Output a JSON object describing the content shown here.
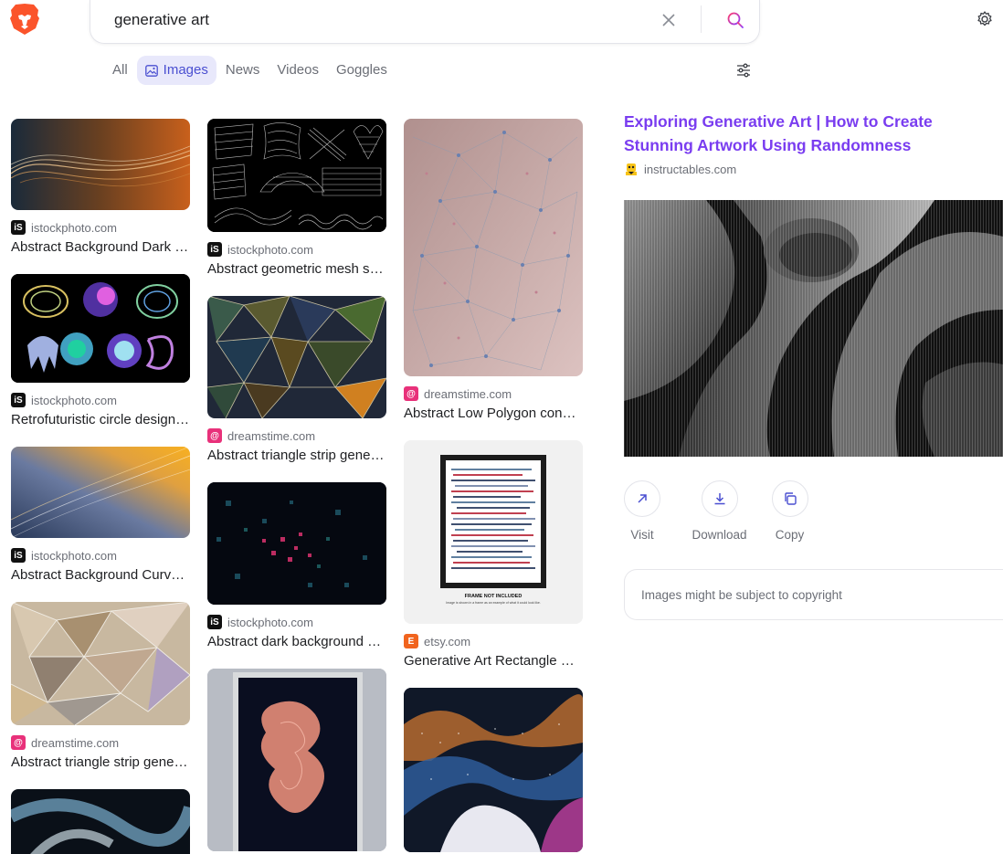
{
  "search": {
    "query": "generative art"
  },
  "tabs": [
    {
      "label": "All"
    },
    {
      "label": "Images"
    },
    {
      "label": "News"
    },
    {
      "label": "Videos"
    },
    {
      "label": "Goggles"
    }
  ],
  "results": {
    "col1": [
      {
        "domain": "istockphoto.com",
        "title": "Abstract Background Dark Orange Wave",
        "favicon": "istock-icon"
      },
      {
        "domain": "istockphoto.com",
        "title": "Retrofuturistic circle design elements",
        "favicon": "istock-icon"
      },
      {
        "domain": "istockphoto.com",
        "title": "Abstract Background Curved Light",
        "favicon": "istock-icon"
      },
      {
        "domain": "dreamstime.com",
        "title": "Abstract triangle strip generative art",
        "favicon": "dreamstime-icon"
      }
    ],
    "col2": [
      {
        "domain": "istockphoto.com",
        "title": "Abstract geometric mesh shapes set",
        "favicon": "istock-icon"
      },
      {
        "domain": "dreamstime.com",
        "title": "Abstract triangle strip generative art",
        "favicon": "dreamstime-icon"
      },
      {
        "domain": "istockphoto.com",
        "title": "Abstract dark background with squares",
        "favicon": "istock-icon"
      }
    ],
    "col3": [
      {
        "domain": "dreamstime.com",
        "title": "Abstract Low Polygon connection",
        "favicon": "dreamstime-icon"
      },
      {
        "domain": "etsy.com",
        "title": "Generative Art Rectangle Print",
        "favicon": "etsy-icon"
      }
    ]
  },
  "detail": {
    "title": "Exploring Generative Art | How to Create Stunning Artwork Using Randomness",
    "source": "instructables.com",
    "actions": [
      {
        "label": "Visit",
        "icon": "arrow-up-right-icon"
      },
      {
        "label": "Download",
        "icon": "download-icon"
      },
      {
        "label": "Copy",
        "icon": "copy-icon"
      }
    ],
    "copyright": "Images might be subject to copyright"
  },
  "etsy_print": {
    "frame_text": "FRAME NOT INCLUDED",
    "frame_caption": "Image is shown in a frame as an example of what it could look like."
  },
  "colors": {
    "accent": "#4a4fd1",
    "title_purple": "#7a3df0",
    "istock": "#111111",
    "dreamstime": "#e8317a",
    "etsy": "#f1641e"
  }
}
